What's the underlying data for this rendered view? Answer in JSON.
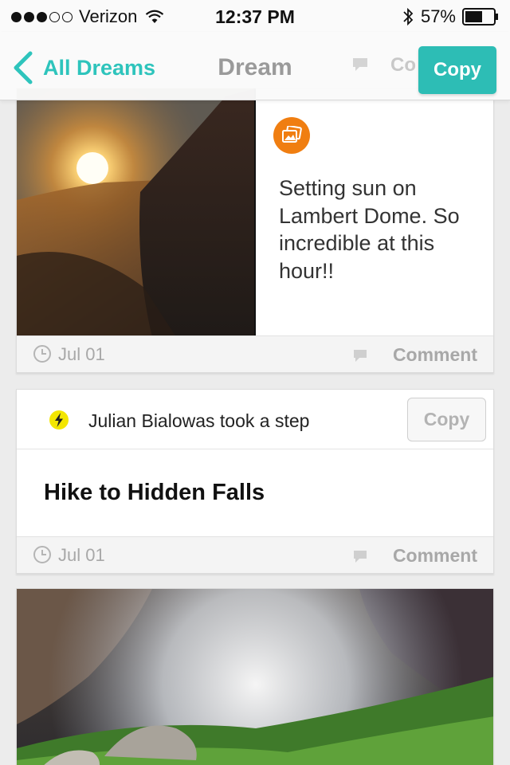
{
  "status_bar": {
    "carrier": "Verizon",
    "time": "12:37 PM",
    "battery": "57%"
  },
  "nav": {
    "back_label": "All Dreams",
    "title": "Dream",
    "ghost_comment": "Co",
    "copy_label": "Copy"
  },
  "cards": [
    {
      "type": "photo",
      "caption": "Setting sun on Lambert Dome. So incredible at this hour!!",
      "date": "Jul 01",
      "comment_label": "Comment"
    },
    {
      "type": "step",
      "actor_text": "Julian Bialowas took a step",
      "copy_label": "Copy",
      "title": "Hike to Hidden Falls",
      "date": "Jul 01",
      "comment_label": "Comment"
    },
    {
      "type": "photo"
    }
  ],
  "colors": {
    "accent": "#2ec4bc",
    "photo_badge": "#f07e11",
    "step_bolt": "#f3e600"
  }
}
